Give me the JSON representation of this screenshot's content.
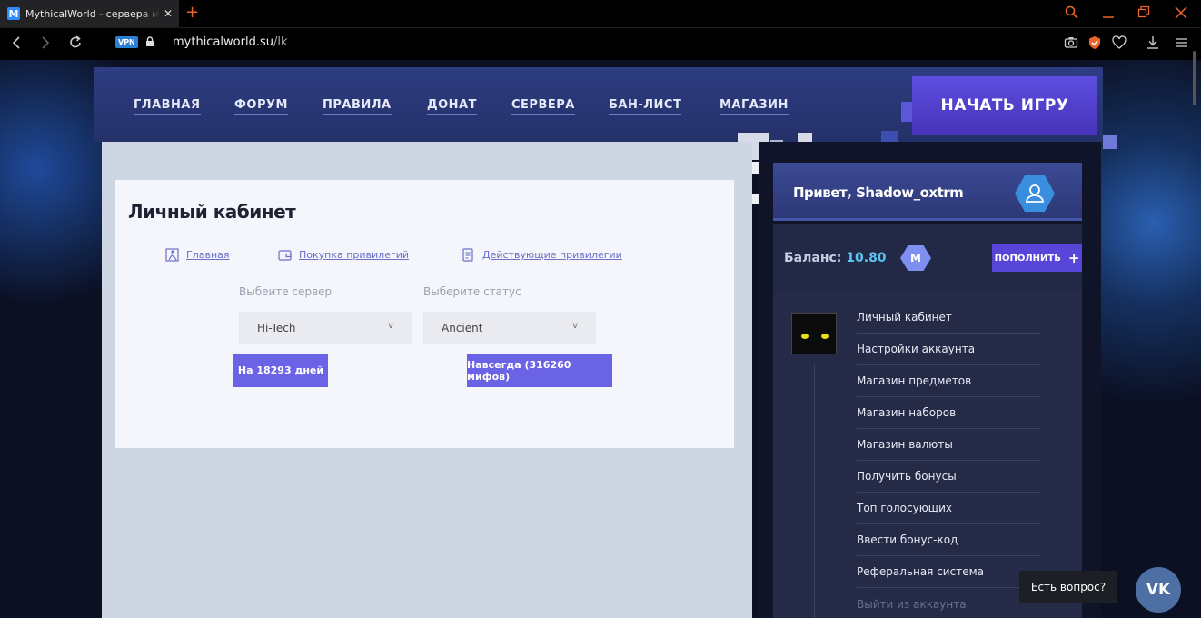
{
  "browser": {
    "tab_title": "MythicalWorld - сервера м",
    "tab_close": "✕",
    "new_tab": "+",
    "vpn_badge": "VPN",
    "url_host": "mythicalworld.su",
    "url_path": "/lk",
    "accent_color": "#e9652b"
  },
  "nav": {
    "items": [
      "ГЛАВНАЯ",
      "ФОРУМ",
      "ПРАВИЛА",
      "ДОНАТ",
      "СЕРВЕРА",
      "БАН-ЛИСТ",
      "МАГАЗИН"
    ],
    "play_button": "НАЧАТЬ ИГРУ"
  },
  "cabinet": {
    "title": "Личный кабинет",
    "links": [
      "Главная",
      "Покупка привилегий",
      "Действующие привилегии"
    ],
    "server_label": "Выбеите сервер",
    "status_label": "Выберите статус",
    "server_value": "Hi-Tech",
    "status_value": "Ancient",
    "chevron": "v",
    "buy_days": "На 18293 дней",
    "buy_forever": "Навсегда (316260 мифов)"
  },
  "sidebar": {
    "greeting": "Привет, Shadow_oxtrm",
    "balance_label": "Баланс:",
    "balance_value": "10.80",
    "coin_letter": "M",
    "topup_label": "ПОПОЛНИТЬ",
    "topup_plus": "+",
    "menu": [
      "Личный кабинет",
      "Настройки аккаунта",
      "Магазин предметов",
      "Магазин наборов",
      "Магазин валюты",
      "Получить бонусы",
      "Топ голосующих",
      "Ввести бонус-код",
      "Реферальная система",
      "Выйти из аккаунта"
    ]
  },
  "support": {
    "question": "Есть вопрос?",
    "vk": "VK"
  },
  "colors": {
    "brand_purple": "#5846d9",
    "button_purple": "#6b63e6",
    "balance_blue": "#5ec3f0"
  }
}
